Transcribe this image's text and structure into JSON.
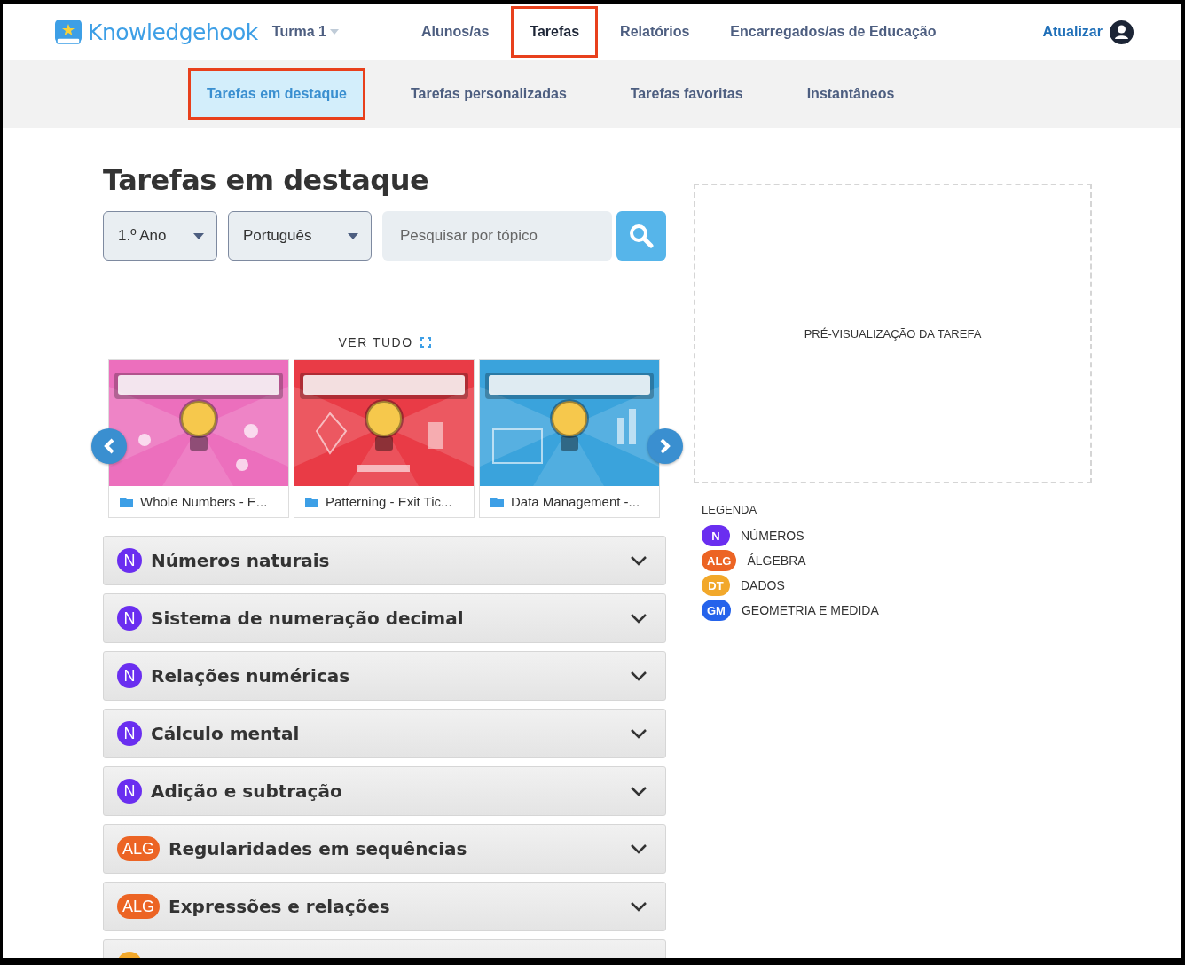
{
  "header": {
    "logo": "Knowledgehook",
    "class_selector": "Turma 1",
    "nav": [
      {
        "label": "Alunos/as",
        "selected": false,
        "highlighted": false
      },
      {
        "label": "Tarefas",
        "selected": true,
        "highlighted": true
      },
      {
        "label": "Relatórios",
        "selected": false,
        "highlighted": false
      },
      {
        "label": "Encarregados/as de Educação",
        "selected": false,
        "highlighted": false
      }
    ],
    "update_link": "Atualizar"
  },
  "subnav": [
    {
      "label": "Tarefas em destaque",
      "selected": true,
      "highlighted": true
    },
    {
      "label": "Tarefas personalizadas",
      "selected": false,
      "highlighted": false
    },
    {
      "label": "Tarefas favoritas",
      "selected": false,
      "highlighted": false
    },
    {
      "label": "Instantâneos",
      "selected": false,
      "highlighted": false
    }
  ],
  "page_title": "Tarefas em destaque",
  "filters": {
    "grade": "1.º Ano",
    "subject": "Português",
    "search": {
      "placeholder": "Pesquisar por tópico"
    }
  },
  "carousel": {
    "see_all": "VER TUDO",
    "cards": [
      {
        "title": "Whole Numbers - E..."
      },
      {
        "title": "Patterning - Exit Tic..."
      },
      {
        "title": "Data Management -..."
      }
    ]
  },
  "topics": [
    {
      "badge": "N",
      "color": "#6a2ef0",
      "title": "Números naturais"
    },
    {
      "badge": "N",
      "color": "#6a2ef0",
      "title": "Sistema de numeração decimal"
    },
    {
      "badge": "N",
      "color": "#6a2ef0",
      "title": "Relações numéricas"
    },
    {
      "badge": "N",
      "color": "#6a2ef0",
      "title": "Cálculo mental"
    },
    {
      "badge": "N",
      "color": "#6a2ef0",
      "title": "Adição e subtração"
    },
    {
      "badge": "ALG",
      "color": "#ec6424",
      "title": "Regularidades em sequências"
    },
    {
      "badge": "ALG",
      "color": "#ec6424",
      "title": "Expressões e relações"
    },
    {
      "color": "#f2a82a"
    }
  ],
  "preview": {
    "label": "PRÉ-VISUALIZAÇÃO DA TAREFA"
  },
  "legend": {
    "title": "LEGENDA",
    "items": [
      {
        "badge": "N",
        "color": "#6a2ef0",
        "label": "NÚMEROS"
      },
      {
        "badge": "ALG",
        "color": "#ec6424",
        "label": "ÁLGEBRA"
      },
      {
        "badge": "DT",
        "color": "#f2a82a",
        "label": "DADOS"
      },
      {
        "badge": "GM",
        "color": "#2563eb",
        "label": "GEOMETRIA E MEDIDA"
      }
    ]
  }
}
